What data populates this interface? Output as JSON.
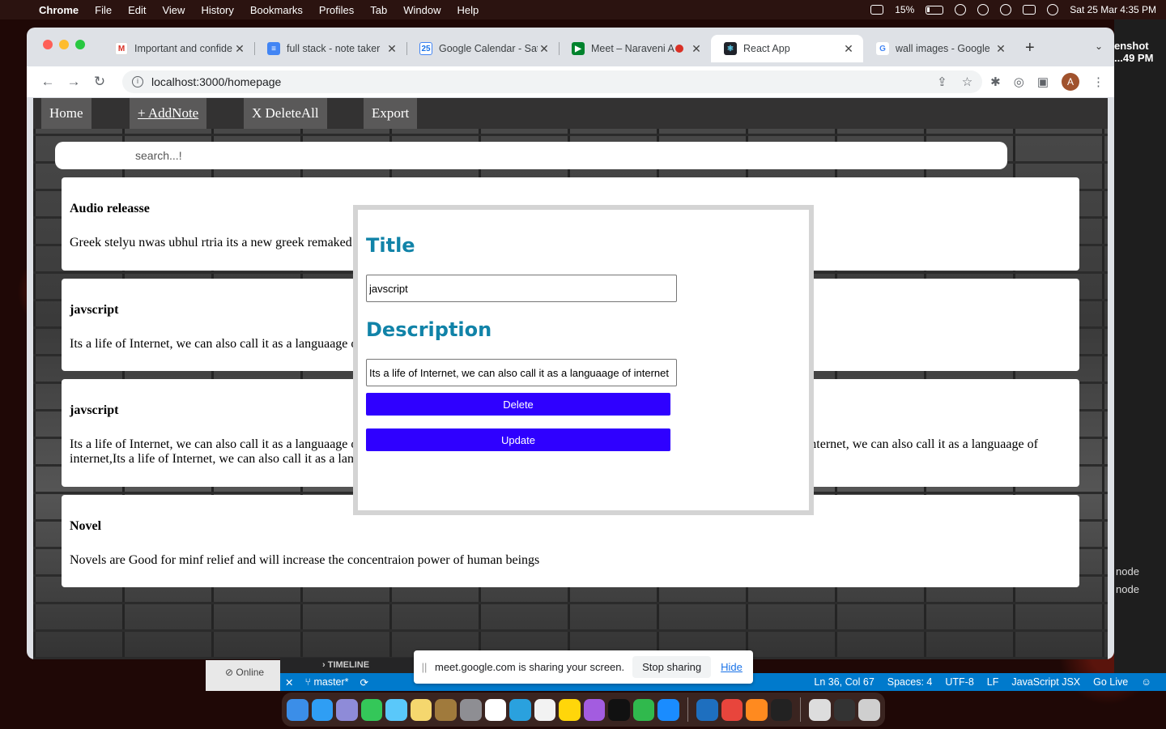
{
  "menubar": {
    "app_name": "Chrome",
    "items": [
      "File",
      "Edit",
      "View",
      "History",
      "Bookmarks",
      "Profiles",
      "Tab",
      "Window",
      "Help"
    ],
    "battery": "15%",
    "datetime": "Sat 25 Mar  4:35 PM"
  },
  "browser": {
    "tabs": [
      {
        "title": "Important and confide",
        "icon": "gmail-icon"
      },
      {
        "title": "full stack - note taker",
        "icon": "docs-icon"
      },
      {
        "title": "Google Calendar - Sat",
        "icon": "calendar-icon"
      },
      {
        "title": "Meet – Naraveni A",
        "icon": "meet-icon"
      },
      {
        "title": "React App",
        "icon": "react-icon"
      },
      {
        "title": "wall images - Google",
        "icon": "google-icon"
      }
    ],
    "url": "localhost:3000/homepage",
    "profile_initial": "A"
  },
  "app": {
    "nav": {
      "home": "Home",
      "add": "+ AddNote",
      "delete_all": "X DeleteAll",
      "export": "Export"
    },
    "search_placeholder": "search...!",
    "notes": [
      {
        "title": "Audio releasse",
        "body": "Greek stelyu nwas ubhul rtria its a new greek remaked"
      },
      {
        "title": "javscript",
        "body": "Its a life of Internet, we can also call it as a languaage of internet"
      },
      {
        "title": "javscript",
        "body": "Its a life of Internet, we can also call it as a languaage of internet,Its a life of Internet, we can also call it as a languaage of internet,Its a life of Internet, we can also call it as a languaage of internet,Its a life of Internet, we can also call it as a languaage of internet,Its a life of Internet, we can also call it as a languaage of internet"
      },
      {
        "title": "Novel",
        "body": "Novels are Good for minf relief and will increase the concentraion power of human beings"
      }
    ],
    "modal": {
      "title_label": "Title",
      "title_value": "javscript",
      "description_label": "Description",
      "description_value": "Its a life of Internet, we can also call it as a languaage of internet",
      "delete": "Delete",
      "update": "Update"
    }
  },
  "share_banner": {
    "message": "meet.google.com is sharing your screen.",
    "stop": "Stop sharing",
    "hide": "Hide"
  },
  "vscode": {
    "timeline": "TIMELINE",
    "online": "Online",
    "branch": "master*",
    "position": "Ln 36, Col 67",
    "spaces": "Spaces: 4",
    "encoding": "UTF-8",
    "eol": "LF",
    "language": "JavaScript JSX",
    "golive": "Go Live",
    "side_label_1": "enshot",
    "side_label_2": "...49 PM",
    "terminal_1": "node",
    "terminal_2": "node"
  }
}
